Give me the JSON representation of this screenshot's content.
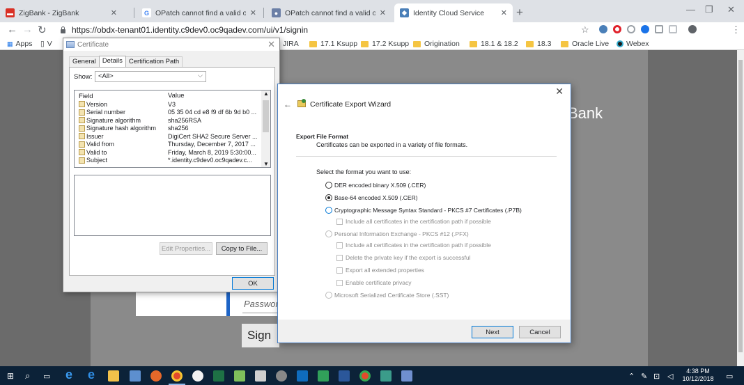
{
  "browser": {
    "tabs": [
      {
        "title": "ZigBank - ZigBank",
        "favicon_color": "#d93025",
        "favicon_glyph": "▬"
      },
      {
        "title": "OPatch cannot find a valid oraIn",
        "favicon_color": "#ffffff",
        "favicon_glyph": "G"
      },
      {
        "title": "OPatch cannot find a valid oraIn",
        "favicon_color": "#6b7fa6",
        "favicon_glyph": "●"
      },
      {
        "title": "Identity Cloud Service",
        "favicon_color": "#4a7fb8",
        "favicon_glyph": "◆"
      }
    ],
    "new_tab_glyph": "+",
    "url": "https://obdx-tenant01.identity.c9dev0.oc9qadev.com/ui/v1/signin",
    "bookmarks": [
      {
        "label": "Apps"
      },
      {
        "label": "V"
      },
      {
        "label": "JIRA"
      },
      {
        "label": "17.1 Ksupp"
      },
      {
        "label": "17.2 Ksupp"
      },
      {
        "label": "Origination"
      },
      {
        "label": "18.1 & 18.2"
      },
      {
        "label": "18.3"
      },
      {
        "label": "Oracle Live"
      },
      {
        "label": "Webex"
      }
    ]
  },
  "page": {
    "brand_partial": "Bank",
    "password_placeholder": "Passworc",
    "signin_partial": "Sign"
  },
  "certificate": {
    "title": "Certificate",
    "tabs": [
      "General",
      "Details",
      "Certification Path"
    ],
    "show_label": "Show:",
    "show_value": "<All>",
    "columns": {
      "field": "Field",
      "value": "Value"
    },
    "rows": [
      {
        "field": "Version",
        "value": "V3"
      },
      {
        "field": "Serial number",
        "value": "05 35 04 cd e8 f9 df 6b 9d b0 ..."
      },
      {
        "field": "Signature algorithm",
        "value": "sha256RSA"
      },
      {
        "field": "Signature hash algorithm",
        "value": "sha256"
      },
      {
        "field": "Issuer",
        "value": "DigiCert SHA2 Secure Server ..."
      },
      {
        "field": "Valid from",
        "value": "Thursday, December 7, 2017 ..."
      },
      {
        "field": "Valid to",
        "value": "Friday, March 8, 2019 5:30:00..."
      },
      {
        "field": "Subject",
        "value": "*.identity.c9dev0.oc9qadev.c..."
      }
    ],
    "edit_properties": "Edit Properties...",
    "copy_to_file": "Copy to File...",
    "ok": "OK"
  },
  "wizard": {
    "title": "Certificate Export Wizard",
    "heading": "Export File Format",
    "subheading": "Certificates can be exported in a variety of file formats.",
    "prompt": "Select the format you want to use:",
    "options": [
      {
        "label": "DER encoded binary X.509 (.CER)"
      },
      {
        "label": "Base-64 encoded X.509 (.CER)"
      },
      {
        "label": "Cryptographic Message Syntax Standard - PKCS #7 Certificates (.P7B)"
      },
      {
        "label": "Include all certificates in the certification path if possible"
      },
      {
        "label": "Personal Information Exchange - PKCS #12 (.PFX)"
      },
      {
        "label": "Include all certificates in the certification path if possible"
      },
      {
        "label": "Delete the private key if the export is successful"
      },
      {
        "label": "Export all extended properties"
      },
      {
        "label": "Enable certificate privacy"
      },
      {
        "label": "Microsoft Serialized Certificate Store (.SST)"
      }
    ],
    "selected_option": "Base-64 encoded X.509 (.CER)",
    "next": "Next",
    "cancel": "Cancel"
  },
  "taskbar": {
    "time": "4:38 PM",
    "date": "10/12/2018"
  }
}
